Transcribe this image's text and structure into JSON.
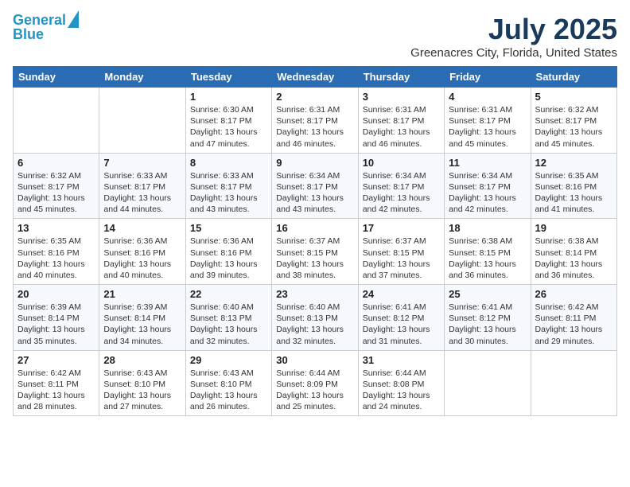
{
  "logo": {
    "line1": "General",
    "line2": "Blue"
  },
  "title": "July 2025",
  "location": "Greenacres City, Florida, United States",
  "weekdays": [
    "Sunday",
    "Monday",
    "Tuesday",
    "Wednesday",
    "Thursday",
    "Friday",
    "Saturday"
  ],
  "weeks": [
    [
      {
        "day": "",
        "sunrise": "",
        "sunset": "",
        "daylight": ""
      },
      {
        "day": "",
        "sunrise": "",
        "sunset": "",
        "daylight": ""
      },
      {
        "day": "1",
        "sunrise": "Sunrise: 6:30 AM",
        "sunset": "Sunset: 8:17 PM",
        "daylight": "Daylight: 13 hours and 47 minutes."
      },
      {
        "day": "2",
        "sunrise": "Sunrise: 6:31 AM",
        "sunset": "Sunset: 8:17 PM",
        "daylight": "Daylight: 13 hours and 46 minutes."
      },
      {
        "day": "3",
        "sunrise": "Sunrise: 6:31 AM",
        "sunset": "Sunset: 8:17 PM",
        "daylight": "Daylight: 13 hours and 46 minutes."
      },
      {
        "day": "4",
        "sunrise": "Sunrise: 6:31 AM",
        "sunset": "Sunset: 8:17 PM",
        "daylight": "Daylight: 13 hours and 45 minutes."
      },
      {
        "day": "5",
        "sunrise": "Sunrise: 6:32 AM",
        "sunset": "Sunset: 8:17 PM",
        "daylight": "Daylight: 13 hours and 45 minutes."
      }
    ],
    [
      {
        "day": "6",
        "sunrise": "Sunrise: 6:32 AM",
        "sunset": "Sunset: 8:17 PM",
        "daylight": "Daylight: 13 hours and 45 minutes."
      },
      {
        "day": "7",
        "sunrise": "Sunrise: 6:33 AM",
        "sunset": "Sunset: 8:17 PM",
        "daylight": "Daylight: 13 hours and 44 minutes."
      },
      {
        "day": "8",
        "sunrise": "Sunrise: 6:33 AM",
        "sunset": "Sunset: 8:17 PM",
        "daylight": "Daylight: 13 hours and 43 minutes."
      },
      {
        "day": "9",
        "sunrise": "Sunrise: 6:34 AM",
        "sunset": "Sunset: 8:17 PM",
        "daylight": "Daylight: 13 hours and 43 minutes."
      },
      {
        "day": "10",
        "sunrise": "Sunrise: 6:34 AM",
        "sunset": "Sunset: 8:17 PM",
        "daylight": "Daylight: 13 hours and 42 minutes."
      },
      {
        "day": "11",
        "sunrise": "Sunrise: 6:34 AM",
        "sunset": "Sunset: 8:17 PM",
        "daylight": "Daylight: 13 hours and 42 minutes."
      },
      {
        "day": "12",
        "sunrise": "Sunrise: 6:35 AM",
        "sunset": "Sunset: 8:16 PM",
        "daylight": "Daylight: 13 hours and 41 minutes."
      }
    ],
    [
      {
        "day": "13",
        "sunrise": "Sunrise: 6:35 AM",
        "sunset": "Sunset: 8:16 PM",
        "daylight": "Daylight: 13 hours and 40 minutes."
      },
      {
        "day": "14",
        "sunrise": "Sunrise: 6:36 AM",
        "sunset": "Sunset: 8:16 PM",
        "daylight": "Daylight: 13 hours and 40 minutes."
      },
      {
        "day": "15",
        "sunrise": "Sunrise: 6:36 AM",
        "sunset": "Sunset: 8:16 PM",
        "daylight": "Daylight: 13 hours and 39 minutes."
      },
      {
        "day": "16",
        "sunrise": "Sunrise: 6:37 AM",
        "sunset": "Sunset: 8:15 PM",
        "daylight": "Daylight: 13 hours and 38 minutes."
      },
      {
        "day": "17",
        "sunrise": "Sunrise: 6:37 AM",
        "sunset": "Sunset: 8:15 PM",
        "daylight": "Daylight: 13 hours and 37 minutes."
      },
      {
        "day": "18",
        "sunrise": "Sunrise: 6:38 AM",
        "sunset": "Sunset: 8:15 PM",
        "daylight": "Daylight: 13 hours and 36 minutes."
      },
      {
        "day": "19",
        "sunrise": "Sunrise: 6:38 AM",
        "sunset": "Sunset: 8:14 PM",
        "daylight": "Daylight: 13 hours and 36 minutes."
      }
    ],
    [
      {
        "day": "20",
        "sunrise": "Sunrise: 6:39 AM",
        "sunset": "Sunset: 8:14 PM",
        "daylight": "Daylight: 13 hours and 35 minutes."
      },
      {
        "day": "21",
        "sunrise": "Sunrise: 6:39 AM",
        "sunset": "Sunset: 8:14 PM",
        "daylight": "Daylight: 13 hours and 34 minutes."
      },
      {
        "day": "22",
        "sunrise": "Sunrise: 6:40 AM",
        "sunset": "Sunset: 8:13 PM",
        "daylight": "Daylight: 13 hours and 32 minutes."
      },
      {
        "day": "23",
        "sunrise": "Sunrise: 6:40 AM",
        "sunset": "Sunset: 8:13 PM",
        "daylight": "Daylight: 13 hours and 32 minutes."
      },
      {
        "day": "24",
        "sunrise": "Sunrise: 6:41 AM",
        "sunset": "Sunset: 8:12 PM",
        "daylight": "Daylight: 13 hours and 31 minutes."
      },
      {
        "day": "25",
        "sunrise": "Sunrise: 6:41 AM",
        "sunset": "Sunset: 8:12 PM",
        "daylight": "Daylight: 13 hours and 30 minutes."
      },
      {
        "day": "26",
        "sunrise": "Sunrise: 6:42 AM",
        "sunset": "Sunset: 8:11 PM",
        "daylight": "Daylight: 13 hours and 29 minutes."
      }
    ],
    [
      {
        "day": "27",
        "sunrise": "Sunrise: 6:42 AM",
        "sunset": "Sunset: 8:11 PM",
        "daylight": "Daylight: 13 hours and 28 minutes."
      },
      {
        "day": "28",
        "sunrise": "Sunrise: 6:43 AM",
        "sunset": "Sunset: 8:10 PM",
        "daylight": "Daylight: 13 hours and 27 minutes."
      },
      {
        "day": "29",
        "sunrise": "Sunrise: 6:43 AM",
        "sunset": "Sunset: 8:10 PM",
        "daylight": "Daylight: 13 hours and 26 minutes."
      },
      {
        "day": "30",
        "sunrise": "Sunrise: 6:44 AM",
        "sunset": "Sunset: 8:09 PM",
        "daylight": "Daylight: 13 hours and 25 minutes."
      },
      {
        "day": "31",
        "sunrise": "Sunrise: 6:44 AM",
        "sunset": "Sunset: 8:08 PM",
        "daylight": "Daylight: 13 hours and 24 minutes."
      },
      {
        "day": "",
        "sunrise": "",
        "sunset": "",
        "daylight": ""
      },
      {
        "day": "",
        "sunrise": "",
        "sunset": "",
        "daylight": ""
      }
    ]
  ]
}
